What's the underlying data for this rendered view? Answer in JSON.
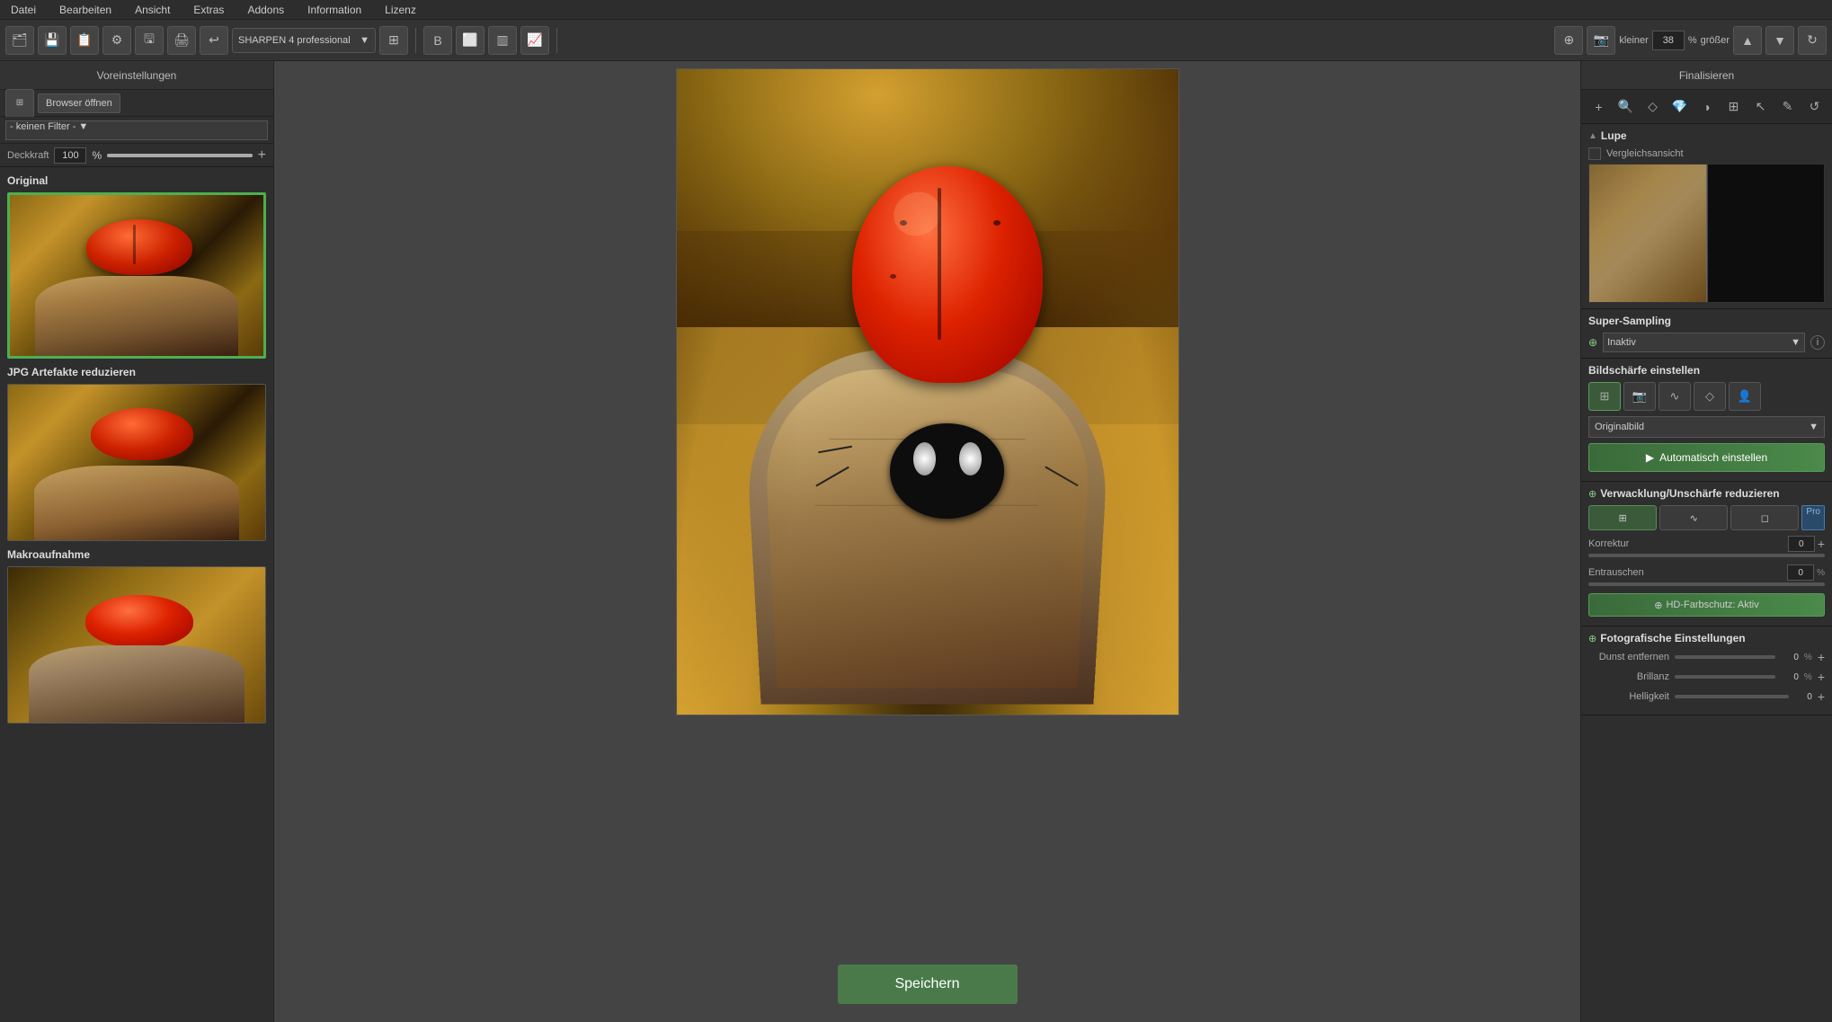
{
  "menubar": {
    "items": [
      {
        "label": "Datei"
      },
      {
        "label": "Bearbeiten"
      },
      {
        "label": "Ansicht"
      },
      {
        "label": "Extras"
      },
      {
        "label": "Addons"
      },
      {
        "label": "Information"
      },
      {
        "label": "Lizenz"
      }
    ]
  },
  "toolbar": {
    "plugin_name": "SHARPEN 4 professional",
    "zoom_label_small": "kleiner",
    "zoom_value": "38",
    "zoom_unit": "%",
    "zoom_label_large": "größer"
  },
  "left_panel": {
    "header": "Voreinstellungen",
    "open_browser_btn": "Browser öffnen",
    "filter_placeholder": "- keinen Filter -",
    "opacity_label": "Deckkraft",
    "opacity_value": "100",
    "opacity_unit": "%",
    "sections": [
      {
        "label": "Original"
      },
      {
        "label": "JPG Artefakte reduzieren"
      },
      {
        "label": "Makroaufnahme"
      }
    ]
  },
  "right_panel": {
    "header": "Finalisieren",
    "lupe_title": "Lupe",
    "vergleich_label": "Vergleichsansicht",
    "super_sampling_title": "Super-Sampling",
    "super_sampling_value": "Inaktiv",
    "bildschaerfe_title": "Bildschärfe einstellen",
    "originalbild_label": "Originalbild",
    "auto_btn": "Automatisch einstellen",
    "verwacklung_title": "Verwacklung/Unschärfe reduzieren",
    "pro_badge": "Pro",
    "korrektur_label": "Korrektur",
    "korrektur_value": "0",
    "entrauschen_label": "Entrauschen",
    "entrauschen_value": "0",
    "entrauschen_unit": "%",
    "hd_btn": "HD-Farbschutz: Aktiv",
    "foto_title": "Fotografische Einstellungen",
    "dunst_label": "Dunst entfernen",
    "dunst_value": "0",
    "dunst_unit": "%",
    "brillanz_label": "Brillanz",
    "brillanz_value": "0",
    "brillanz_unit": "%",
    "helligkeit_label": "Helligkeit",
    "helligkeit_value": "0"
  },
  "canvas": {
    "save_btn": "Speichern"
  }
}
